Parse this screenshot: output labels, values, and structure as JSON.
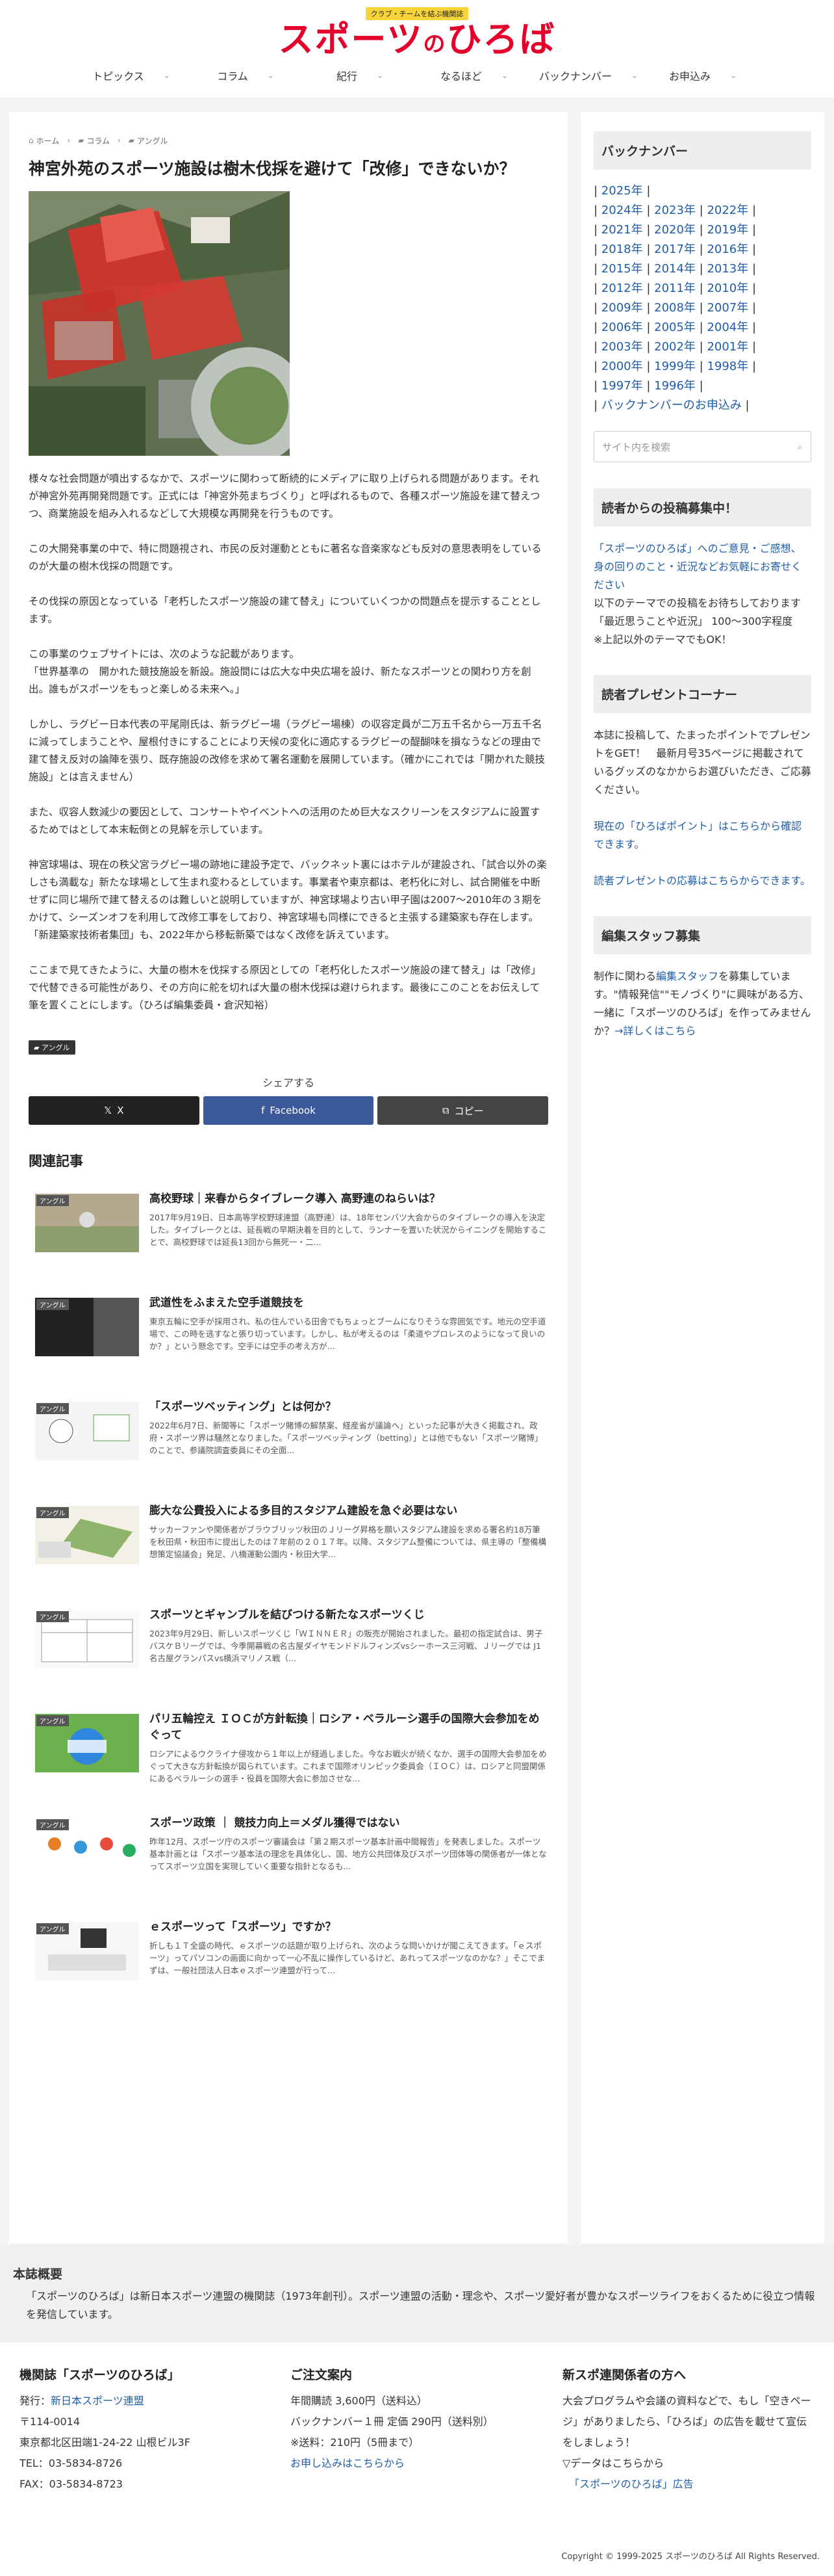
{
  "header": {
    "tagline": "クラブ・チームを結ぶ機関誌",
    "site_name_a": "スポーツ",
    "site_name_no": "の",
    "site_name_b": "ひろば",
    "nav": [
      "トピックス",
      "コラム",
      "紀行",
      "なるほど",
      "バックナンバー",
      "お申込み"
    ]
  },
  "breadcrumb": [
    "ホーム",
    "コラム",
    "アングル"
  ],
  "article": {
    "title": "神宮外苑のスポーツ施設は樹木伐採を避けて「改修」できないか？",
    "paragraphs": [
      "様々な社会問題が噴出するなかで、スポーツに関わって断続的にメディアに取り上げられる問題があります。それが神宮外苑再開発問題です。正式には「神宮外苑まちづくり」と呼ばれるもので、各種スポーツ施設を建て替えつつ、商業施設を組み入れるなどして大規模な再開発を行うものです。",
      "この大開発事業の中で、特に問題視され、市民の反対運動とともに著名な音楽家なども反対の意思表明をしているのが大量の樹木伐採の問題です。",
      "その伐採の原因となっている「老朽したスポーツ施設の建て替え」についていくつかの問題点を提示することとします。",
      "この事業のウェブサイトには、次のような記載があります。\n「世界基準の　開かれた競技施設を新設。施設間には広大な中央広場を設け、新たなスポーツとの関わり方を創出。誰もがスポーツをもっと楽しめる未来へ。」",
      "しかし、ラグビー日本代表の平尾剛氏は、新ラグビー場（ラグビー場棟）の収容定員が二万五千名から一万五千名に減ってしまうことや、屋根付きにすることにより天候の変化に適応するラグビーの醍醐味を損なうなどの理由で建て替え反対の論陣を張り、既存施設の改修を求めて署名運動を展開しています。（確かにこれでは「開かれた競技施設」とは言えません）",
      "また、収容人数減少の要因として、コンサートやイベントへの活用のため巨大なスクリーンをスタジアムに設置するためではとして本末転倒との見解を示しています。",
      "神宮球場は、現在の秩父宮ラグビー場の跡地に建設予定で、バックネット裏にはホテルが建設され、「試合以外の楽しさも満載な」新たな球場として生まれ変わるとしています。事業者や東京都は、老朽化に対し、試合開催を中断せずに同じ場所で建て替えるのは難しいと説明していますが、神宮球場より古い甲子園は2007～2010年の３期をかけて、シーズンオフを利用して改修工事をしており、神宮球場も同様にできると主張する建築家も存在します。「新建築家技術者集団」も、2022年から移転新築ではなく改修を訴えています。",
      "ここまで見てきたように、大量の樹木を伐採する原因としての「老朽化したスポーツ施設の建て替え」は「改修」で代替できる可能性があり、その方向に舵を切れば大量の樹木伐採は避けられます。最後にこのことをお伝えして筆を置くことにします。（ひろば編集委員・倉沢知裕）"
    ],
    "category": "アングル",
    "share_title": "シェアする",
    "share_buttons": [
      "X",
      "Facebook",
      "コピー"
    ]
  },
  "related": {
    "title": "関連記事",
    "badge": "アングル",
    "items": [
      {
        "title": "高校野球｜来春からタイブレーク導入 高野連のねらいは？",
        "summary": "2017年9月19日、日本高等学校野球連盟（高野連）は、18年センバツ大会からのタイブレークの導入を決定した。タイブレークとは、延長戦の早期決着を目的として、ランナーを置いた状況からイニングを開始することで、高校野球では延長13回から無死一・二..."
      },
      {
        "title": "武道性をふまえた空手道競技を",
        "summary": "東京五輪に空手が採用され、私の住んでいる田舎でもちょっとブームになりそうな雰囲気です。地元の空手道場で、この時を逃すなと張り切っています。しかし、私が考えるのは「柔道やプロレスのようになって良いのか？」という懸念です。空手には空手の考え方が..."
      },
      {
        "title": "「スポーツベッティング」とは何か？",
        "summary": "2022年6月7日、新聞等に「スポーツ賭博の解禁案、経産省が議論へ」といった記事が大きく掲載され、政府・スポーツ界は騒然となりました。「スポーツベッティング（betting）」とは他でもない「スポーツ賭博」のことで、参議院調査委員にその全面..."
      },
      {
        "title": "膨大な公費投入による多目的スタジアム建設を急ぐ必要はない",
        "summary": "サッカーファンや関係者がブラウブリッツ秋田のＪリーグ昇格を願いスタジアム建設を求める署名約18万筆を秋田県・秋田市に提出したのは７年前の２０１７年。以降、スタジアム整備については、県主導の「整備構想策定協議会」発足、八橋運動公園内・秋田大学..."
      },
      {
        "title": "スポーツとギャンブルを結びつける新たなスポーツくじ",
        "summary": "2023年9月29日、新しいスポーツくじ「ＷＩＮＮＥＲ」の販売が開始されました。最初の指定試合は、男子バスケＢリーグでは、今季開幕戦の名古屋ダイヤモンドドルフィンズvsシーホース三河戦、Ｊリーグでは J1名古屋グランパスvs横浜マリノス戦（..."
      },
      {
        "title": "パリ五輪控え ＩＯＣが方針転換｜ロシア・ベラルーシ選手の国際大会参加をめぐって",
        "summary": "ロシアによるウクライナ侵攻から１年以上が経過しました。今なお戦火が続くなか、選手の国際大会参加をめぐって大きな方針転換が図られています。これまで国際オリンピック委員会（ＩＯＣ）は、ロシアと同盟関係にあるベラルーシの選手・役員を国際大会に参加させな..."
      },
      {
        "title": "スポーツ政策 ｜ 競技力向上＝メダル獲得ではない",
        "summary": "昨年12月、スポーツ庁のスポーツ審議会は「第２期スポーツ基本計画中間報告」を発表しました。スポーツ基本計画とは「スポーツ基本法の理念を具体化し、国、地方公共団体及びスポーツ団体等の関係者が一体となってスポーツ立国を実現していく重要な指針となるも..."
      },
      {
        "title": "ｅスポーツって「スポーツ」ですか？",
        "summary": "折しも１Ｔ全盛の時代、ｅスポーツの話題が取り上げられ、次のような問いかけが聞こえてきます。「ｅスポーツ」ってパソコンの画面に向かって一心不乱に操作しているけど、あれってスポーツなのかな？」そこでまずは、一般社団法人日本ｅスポーツ連盟が行って..."
      }
    ]
  },
  "sidebar": {
    "backnumber_title": "バックナンバー",
    "years": [
      [
        "2025年"
      ],
      [
        "2024年",
        "2023年",
        "2022年"
      ],
      [
        "2021年",
        "2020年",
        "2019年"
      ],
      [
        "2018年",
        "2017年",
        "2016年"
      ],
      [
        "2015年",
        "2014年",
        "2013年"
      ],
      [
        "2012年",
        "2011年",
        "2010年"
      ],
      [
        "2009年",
        "2008年",
        "2007年"
      ],
      [
        "2006年",
        "2005年",
        "2004年"
      ],
      [
        "2003年",
        "2002年",
        "2001年"
      ],
      [
        "2000年",
        "1999年",
        "1998年"
      ],
      [
        "1997年",
        "1996年"
      ],
      [
        "バックナンバーのお申込み"
      ]
    ],
    "search_placeholder": "サイト内を検索",
    "reader_title": "読者からの投稿募集中！",
    "reader_link": "「スポーツのひろば」へのご意見・ご感想、身の回りのこと・近況などお気軽にお寄せください",
    "reader_text": "以下のテーマでの投稿をお待ちしております",
    "reader_theme": "「最近思うことや近況」 100〜300字程度",
    "reader_note": "※上記以外のテーマでもOK！",
    "present_title": "読者プレゼントコーナー",
    "present_text": "本誌に投稿して、たまったポイントでプレゼントをGET！　最新月号35ページに掲載されているグッズのなかからお選びいただき、ご応募ください。",
    "present_link1": "現在の「ひろばポイント」はこちらから確認できます。",
    "present_link2": "読者プレゼントの応募はこちらからできます。",
    "staff_title": "編集スタッフ募集",
    "staff_text_a": "制作に関わる",
    "staff_link": "編集スタッフ",
    "staff_text_b": "を募集しています。\"情報発信\"\"モノづくり\"に興味がある方、一緒に「スポーツのひろば」を作ってみませんか？",
    "staff_more": "→詳しくはこちら"
  },
  "summary": {
    "title": "本誌概要",
    "text": "「スポーツのひろば」は新日本スポーツ連盟の機関誌（1973年創刊）。スポーツ連盟の活動・理念や、スポーツ愛好者が豊かなスポーツライフをおくるために役立つ情報を発信しています。"
  },
  "footer": {
    "col1_title": "機関誌「スポーツのひろば」",
    "col1_publisher_label": "発行：",
    "col1_publisher": "新日本スポーツ連盟",
    "col1_lines": [
      "〒114-0014",
      "東京都北区田端1-24-22 山根ビル3F",
      "TEL：03-5834-8726",
      "FAX：03-5834-8723"
    ],
    "col2_title": "ご注文案内",
    "col2_lines": [
      "年間購読 3,600円（送料込）",
      "バックナンバー１冊 定価 290円（送料別）",
      "※送料：210円（5冊まで）"
    ],
    "col2_link": "お申し込みはこちらから",
    "col3_title": "新スポ連関係者の方へ",
    "col3_text": "大会プログラムや会議の資料などで、もし「空きページ」がありましたら、「ひろば」の広告を載せて宣伝をしましょう！",
    "col3_note": "▽データはこちらから",
    "col3_link": "「スポーツのひろば」広告",
    "copyright": "Copyright © 1999-2025 スポーツのひろば All Rights Reserved."
  },
  "colors": {
    "brand_red": "#e4002b",
    "tag_yellow": "#f7d43a",
    "link_blue": "#1f5da8",
    "x_button": "#222222",
    "facebook_button": "#3b5998",
    "copy_button": "#444444"
  }
}
